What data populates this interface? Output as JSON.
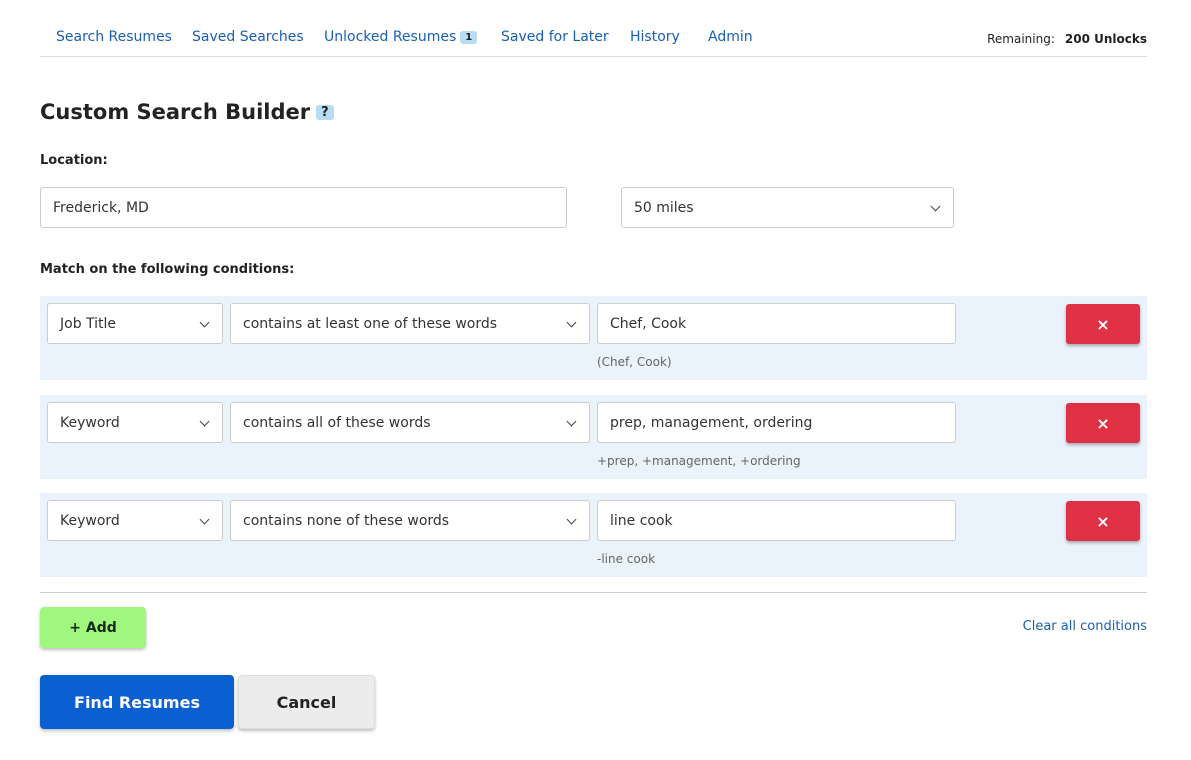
{
  "nav": {
    "items": [
      "Search Resumes",
      "Saved Searches",
      "Unlocked Resumes",
      "Saved for Later",
      "History",
      "Admin"
    ],
    "unlocked_badge": "1",
    "remaining_label": "Remaining:",
    "remaining_value": "200 Unlocks"
  },
  "title": "Custom Search Builder",
  "help": "?",
  "location": {
    "label": "Location:",
    "value": "Frederick, MD",
    "radius": "50 miles"
  },
  "conditions_label": "Match on the following conditions:",
  "conditions": [
    {
      "field": "Job Title",
      "operator": "contains at least one of these words",
      "value": "Chef, Cook",
      "preview": "(Chef, Cook)"
    },
    {
      "field": "Keyword",
      "operator": "contains all of these words",
      "value": "prep, management, ordering",
      "preview": "+prep, +management, +ordering"
    },
    {
      "field": "Keyword",
      "operator": "contains none of these words",
      "value": "line cook",
      "preview": "-line cook"
    }
  ],
  "remove_label": "×",
  "add_label": "+ Add",
  "clear_label": "Clear all conditions",
  "find_label": "Find Resumes",
  "cancel_label": "Cancel",
  "colors": {
    "link": "#1a5fb4",
    "remove": "#e03144",
    "add": "#a0f77e",
    "primary": "#0a5fd1",
    "row_bg": "#eaf2fb"
  }
}
